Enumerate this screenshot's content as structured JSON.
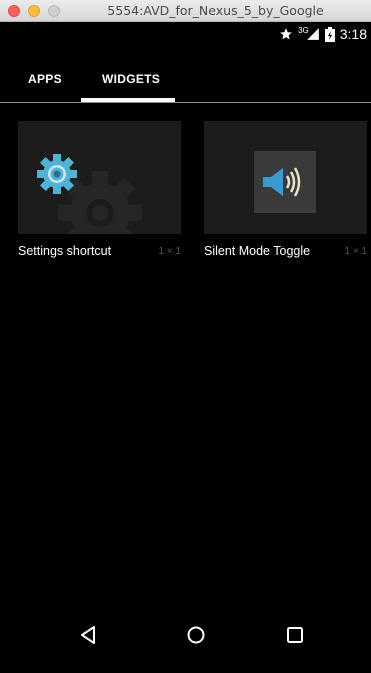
{
  "window": {
    "title": "5554:AVD_for_Nexus_5_by_Google"
  },
  "status_bar": {
    "network": "3G",
    "time": "3:18",
    "icons": [
      "star-icon",
      "signal-icon",
      "battery-icon"
    ]
  },
  "tabs": [
    {
      "label": "APPS",
      "selected": false
    },
    {
      "label": "WIDGETS",
      "selected": true
    }
  ],
  "widgets": [
    {
      "label": "Settings shortcut",
      "size": "1 × 1",
      "icon": "settings-gear-icon"
    },
    {
      "label": "Silent Mode Toggle",
      "size": "1 × 1",
      "icon": "speaker-volume-icon"
    }
  ],
  "nav_bar": {
    "buttons": [
      "back-icon",
      "home-icon",
      "recents-icon"
    ]
  },
  "colors": {
    "background": "#000000",
    "preview_bg": "#1c1c1c",
    "gear_blue": "#4fb3d6",
    "speaker_blue": "#3d9ad1",
    "tab_indicator": "#ffffff"
  }
}
